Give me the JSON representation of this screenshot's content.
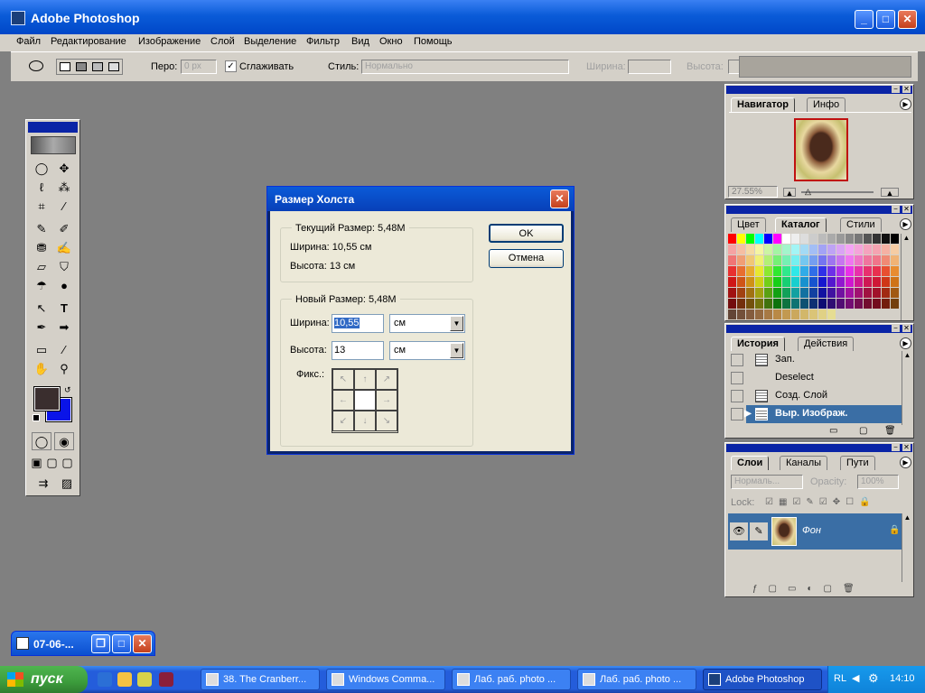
{
  "app": {
    "title": "Adobe Photoshop",
    "menu": [
      "Файл",
      "Редактирование",
      "Изображение",
      "Слой",
      "Выделение",
      "Фильтр",
      "Вид",
      "Окно",
      "Помощь"
    ]
  },
  "options": {
    "feather_label": "Перо:",
    "feather_value": "0 px",
    "antialias_label": "Сглаживать",
    "antialias_checked": true,
    "style_label": "Стиль:",
    "style_value": "Нормально",
    "width_label": "Ширина:",
    "height_label": "Высота:"
  },
  "dialog": {
    "title": "Размер Холста",
    "current_size_label": "Текущий Размер:",
    "current_size_value": "5,48M",
    "current_width": "Ширина: 10,55 см",
    "current_height": "Высота: 13 см",
    "new_size_label": "Новый Размер:",
    "new_size_value": "5,48M",
    "width_label": "Ширина:",
    "width_value": "10,55",
    "width_unit": "см",
    "height_label": "Высота:",
    "height_value": "13",
    "height_unit": "см",
    "anchor_label": "Фикс.:",
    "ok": "OK",
    "cancel": "Отмена"
  },
  "navigator": {
    "tabs": [
      "Навигатор",
      "Инфо"
    ],
    "zoom": "27.55%"
  },
  "swatches": {
    "tabs": [
      "Цвет",
      "Каталог",
      "Стили"
    ],
    "active_tab": "Каталог"
  },
  "history": {
    "tabs": [
      "История",
      "Действия"
    ],
    "items": [
      {
        "label": "Зап."
      },
      {
        "label": "Deselect"
      },
      {
        "label": "Созд. Слой"
      },
      {
        "label": "Выр. Изображ."
      }
    ]
  },
  "layers": {
    "tabs": [
      "Слои",
      "Каналы",
      "Пути"
    ],
    "blend_mode": "Нормаль...",
    "opacity_label": "Opacity:",
    "opacity_value": "100%",
    "lock_label": "Lock:",
    "layer_name": "Фон"
  },
  "minidoc": {
    "title": "07-06-..."
  },
  "taskbar": {
    "start": "пуск",
    "tasks": [
      "38. The Cranberr...",
      "Windows Comma...",
      "Лаб. раб. photo ...",
      "Лаб. раб. photo ...",
      "Adobe Photoshop"
    ],
    "lang": "RL",
    "clock": "14:10"
  },
  "colors": {
    "foreground": "#3a2e2e",
    "background": "#0a14e8",
    "title_blue": "#0a24a6",
    "selection": "#3a6ea5"
  }
}
